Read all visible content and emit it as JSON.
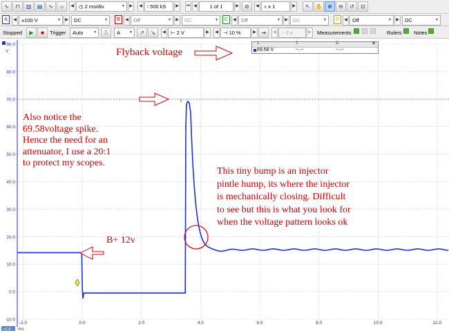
{
  "colors": {
    "trace": "#1a2fd6",
    "annotation": "#cc0000",
    "grid": "#b8b8b8",
    "toolbar": "#eeeeee"
  },
  "toolbar1": {
    "timebase": "2 ms/div",
    "samples": "500 kS",
    "buffer": "1 of 1",
    "zoom": "x 1"
  },
  "toolbar2": {
    "channel_a": {
      "letter": "A",
      "range": "±100 V",
      "coupling": "DC"
    },
    "channel_b": {
      "letter": "B",
      "range": "Off",
      "coupling": "DC"
    },
    "channel_c": {
      "letter": "C",
      "range": "Off",
      "coupling": "DC"
    },
    "channel_d": {
      "letter": "D",
      "range": "Off",
      "coupling": "DC"
    }
  },
  "toolbar3": {
    "status": "Stopped",
    "trigger_label": "Trigger",
    "trigger_mode": "Auto",
    "trigger_channel": "A",
    "trigger_level": "2 V",
    "pre_trigger": "10 %",
    "delay": "0 s",
    "measurements": "Measurements",
    "rulers": "Rulers",
    "notes": "Notes"
  },
  "measurement_table": {
    "headers": [
      "1",
      "2",
      "Δ"
    ],
    "values": [
      "69.58 V",
      "--.--",
      "--.--"
    ]
  },
  "plot": {
    "y_unit": "V",
    "y_ticks": [
      "90.0",
      "80.0",
      "70.0",
      "60.0",
      "50.0",
      "40.0",
      "30.0",
      "20.0",
      "10.0",
      "0.0",
      "-10.0"
    ],
    "x_ticks": [
      "-2.0",
      "0.0",
      "2.0",
      "4.0",
      "6.0",
      "8.0",
      "10.0",
      "12.0"
    ],
    "x_unit": "ms",
    "x_axis_badge": "x1.0"
  },
  "annotations": {
    "flyback": "Flyback voltage",
    "spike": [
      "Also notice the",
      "69.58voltage spike.",
      "Hence the need for an",
      "attenuator, I use a 20:1",
      "to protect my scopes."
    ],
    "bplus": "B+ 12v",
    "bump": [
      "This tiny bump is an injector",
      "pintle hump, its where the injector",
      "is mechanically closing. Difficult",
      "to see but this is what you look for",
      "when the voltage pattern looks ok"
    ]
  }
}
